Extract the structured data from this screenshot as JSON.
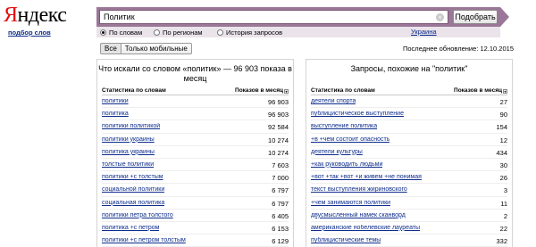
{
  "logo": {
    "text_first": "Я",
    "text_rest": "ндекс",
    "subtitle": "подбор слов"
  },
  "search": {
    "value": "Политик",
    "clear_glyph": "×",
    "button_label": "Подобрать"
  },
  "radios": [
    {
      "label": "По словам",
      "selected": true
    },
    {
      "label": "По регионам",
      "selected": false
    },
    {
      "label": "История запросов",
      "selected": false
    }
  ],
  "region": "Украина",
  "toggle": {
    "all": "Все",
    "mobile": "Только мобильные"
  },
  "updated": "Последнее обновление: 12.10.2015",
  "left_panel": {
    "title": "Что искали со словом «политик» — 96 903 показа в месяц",
    "col_phrase": "Статистика по словам",
    "col_count": "Показов в месяц",
    "rows": [
      {
        "phrase": "политики",
        "count": "96 903"
      },
      {
        "phrase": "политика",
        "count": "96 903"
      },
      {
        "phrase": "политики политикой",
        "count": "92 584"
      },
      {
        "phrase": "политики украины",
        "count": "10 274"
      },
      {
        "phrase": "политика украины",
        "count": "10 274"
      },
      {
        "phrase": "толстые политики",
        "count": "7 603"
      },
      {
        "phrase": "политики +с толстым",
        "count": "7 000"
      },
      {
        "phrase": "социальной политики",
        "count": "6 797"
      },
      {
        "phrase": "социальная политика",
        "count": "6 797"
      },
      {
        "phrase": "политики петра толстого",
        "count": "6 405"
      },
      {
        "phrase": "политика +с петром",
        "count": "6 153"
      },
      {
        "phrase": "политики +с петром толстым",
        "count": "6 129"
      }
    ]
  },
  "right_panel": {
    "title": "Запросы, похожие на \"политик\"",
    "col_phrase": "Статистика по словам",
    "col_count": "Показов в месяц",
    "rows": [
      {
        "phrase": "деятели спорта",
        "count": "27"
      },
      {
        "phrase": "публицистическое выступление",
        "count": "90"
      },
      {
        "phrase": "выступление политика",
        "count": "154"
      },
      {
        "phrase": "+в +чем состоит опасность",
        "count": "12"
      },
      {
        "phrase": "деятели культуры",
        "count": "434"
      },
      {
        "phrase": "+как руководить людьми",
        "count": "30"
      },
      {
        "phrase": "+вот +так +вот +и живем +не понимая",
        "count": "26"
      },
      {
        "phrase": "текст выступления жириновского",
        "count": "3"
      },
      {
        "phrase": "+чем занимаются политики",
        "count": "11"
      },
      {
        "phrase": "двусмысленный намек сканворд",
        "count": "2"
      },
      {
        "phrase": "американские нобелевские лауреаты",
        "count": "22"
      },
      {
        "phrase": "публицистические темы",
        "count": "332"
      }
    ]
  },
  "icons": {
    "sort": "sort-icon",
    "clear": "clear-icon"
  },
  "colors": {
    "search_frame": "#9b7797",
    "link": "#0e2d8c",
    "logo_red": "#e40d0d"
  }
}
